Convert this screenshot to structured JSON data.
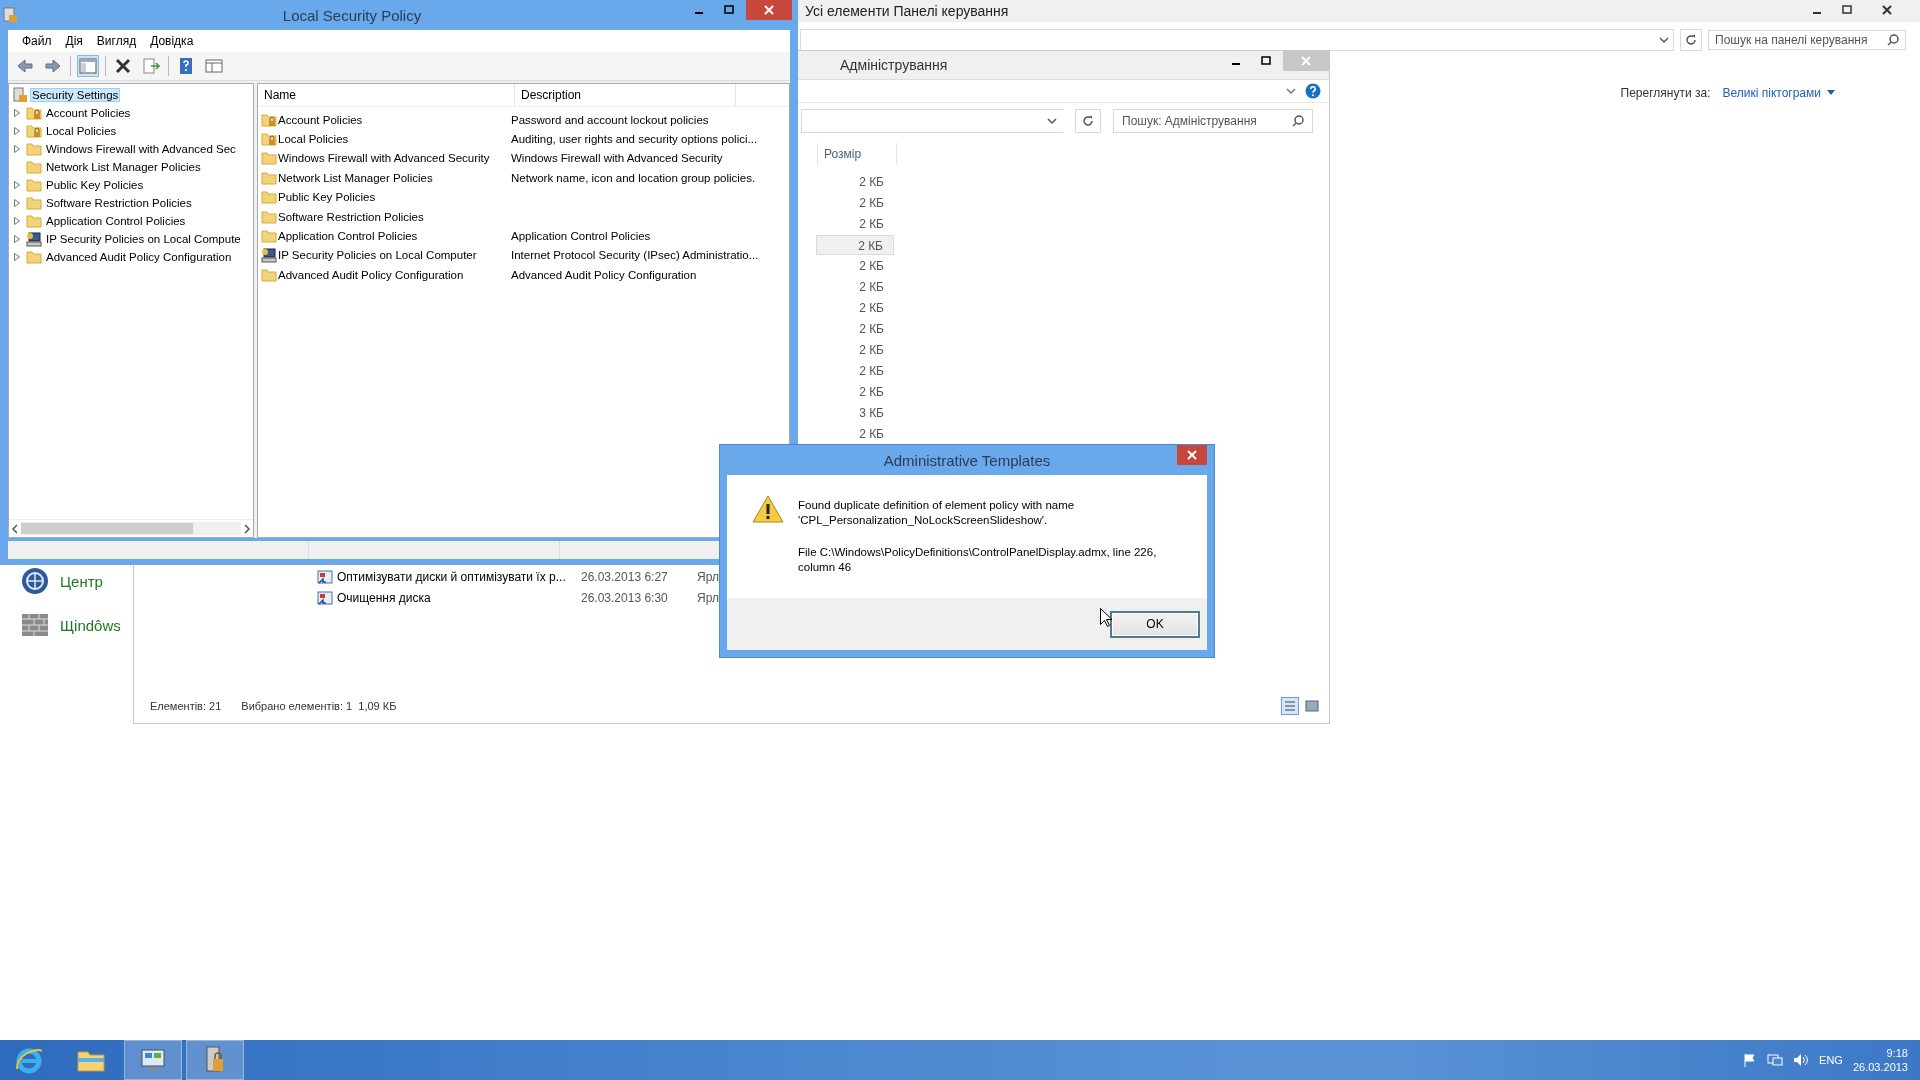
{
  "control_panel": {
    "title": "Усі елементи Панелі керування",
    "search": {
      "placeholder": "Пошук на панелі керування"
    },
    "view_by": {
      "label": "Переглянути за:",
      "value": "Великі піктограми"
    },
    "items": [
      {
        "label": "Центр",
        "kind": "center"
      },
      {
        "label": "Щіndôws",
        "kind": "firewall"
      }
    ]
  },
  "administration": {
    "title": "Адміністрування",
    "search": {
      "placeholder": "Пошук: Адміністрування"
    },
    "size_column": "Розмір",
    "upper_rows": [
      {
        "size": "2 КБ",
        "selected": false
      },
      {
        "size": "2 КБ",
        "selected": false
      },
      {
        "size": "2 КБ",
        "selected": false
      },
      {
        "size": "2 КБ",
        "selected": true
      },
      {
        "size": "2 КБ",
        "selected": false
      },
      {
        "size": "2 КБ",
        "selected": false
      },
      {
        "size": "2 КБ",
        "selected": false
      },
      {
        "size": "2 КБ",
        "selected": false
      },
      {
        "size": "2 КБ",
        "selected": false
      },
      {
        "size": "2 КБ",
        "selected": false
      },
      {
        "size": "2 КБ",
        "selected": false
      },
      {
        "size": "3 КБ",
        "selected": false
      },
      {
        "size": "2 КБ",
        "selected": false
      }
    ],
    "lower_rows": [
      {
        "name": "Оптимізувати диски й оптимізувати їх р...",
        "date": "26.03.2013 6:27",
        "type": "Ярл"
      },
      {
        "name": "Очищення диска",
        "date": "26.03.2013 6:30",
        "type": "Ярл"
      }
    ],
    "status": {
      "count": "Елементів: 21",
      "selection": "Вибрано елементів: 1  1,09 КБ"
    }
  },
  "security_policy": {
    "title": "Local Security Policy",
    "menu": [
      "Файл",
      "Дія",
      "Вигляд",
      "Довідка"
    ],
    "tree": {
      "label": "Security Settings",
      "selected": true,
      "children": [
        {
          "label": "Account Policies",
          "kind": "policy",
          "expandable": true
        },
        {
          "label": "Local Policies",
          "kind": "policy",
          "expandable": true
        },
        {
          "label": "Windows Firewall with Advanced Sec",
          "kind": "folder",
          "expandable": true
        },
        {
          "label": "Network List Manager Policies",
          "kind": "folder",
          "expandable": false
        },
        {
          "label": "Public Key Policies",
          "kind": "folder",
          "expandable": true
        },
        {
          "label": "Software Restriction Policies",
          "kind": "folder",
          "expandable": true
        },
        {
          "label": "Application Control Policies",
          "kind": "folder",
          "expandable": true
        },
        {
          "label": "IP Security Policies on Local Compute",
          "kind": "ipsec",
          "expandable": true
        },
        {
          "label": "Advanced Audit Policy Configuration",
          "kind": "folder",
          "expandable": true
        }
      ]
    },
    "columns": [
      "Name",
      "Description"
    ],
    "rows": [
      {
        "name": "Account Policies",
        "description": "Password and account lockout policies",
        "kind": "policy"
      },
      {
        "name": "Local Policies",
        "description": "Auditing, user rights and security options polici...",
        "kind": "policy"
      },
      {
        "name": "Windows Firewall with Advanced Security",
        "description": "Windows Firewall with Advanced Security",
        "kind": "folder"
      },
      {
        "name": "Network List Manager Policies",
        "description": "Network name, icon and location group policies.",
        "kind": "folder"
      },
      {
        "name": "Public Key Policies",
        "kind": "folder"
      },
      {
        "name": "Software Restriction Policies",
        "kind": "folder"
      },
      {
        "name": "Application Control Policies",
        "description": "Application Control Policies",
        "kind": "folder"
      },
      {
        "name": "IP Security Policies on Local Computer",
        "description": "Internet Protocol Security (IPsec) Administratio...",
        "kind": "ipsec"
      },
      {
        "name": "Advanced Audit Policy Configuration",
        "description": "Advanced Audit Policy Configuration",
        "kind": "folder"
      }
    ]
  },
  "dialog": {
    "title": "Administrative Templates",
    "message": "Found duplicate definition of element policy with name 'CPL_Personalization_NoLockScreenSlideshow'.",
    "detail": "File C:\\Windows\\PolicyDefinitions\\ControlPanelDisplay.admx, line 226, column 46",
    "button": "OK"
  },
  "taskbar": {
    "apps": [
      {
        "kind": "ie",
        "running": false
      },
      {
        "kind": "explorer",
        "running": false
      },
      {
        "kind": "control-panel",
        "running": true
      },
      {
        "kind": "security-policy",
        "running": true
      }
    ],
    "language": "ENG",
    "time": "9:18",
    "date": "26.03.2013"
  }
}
